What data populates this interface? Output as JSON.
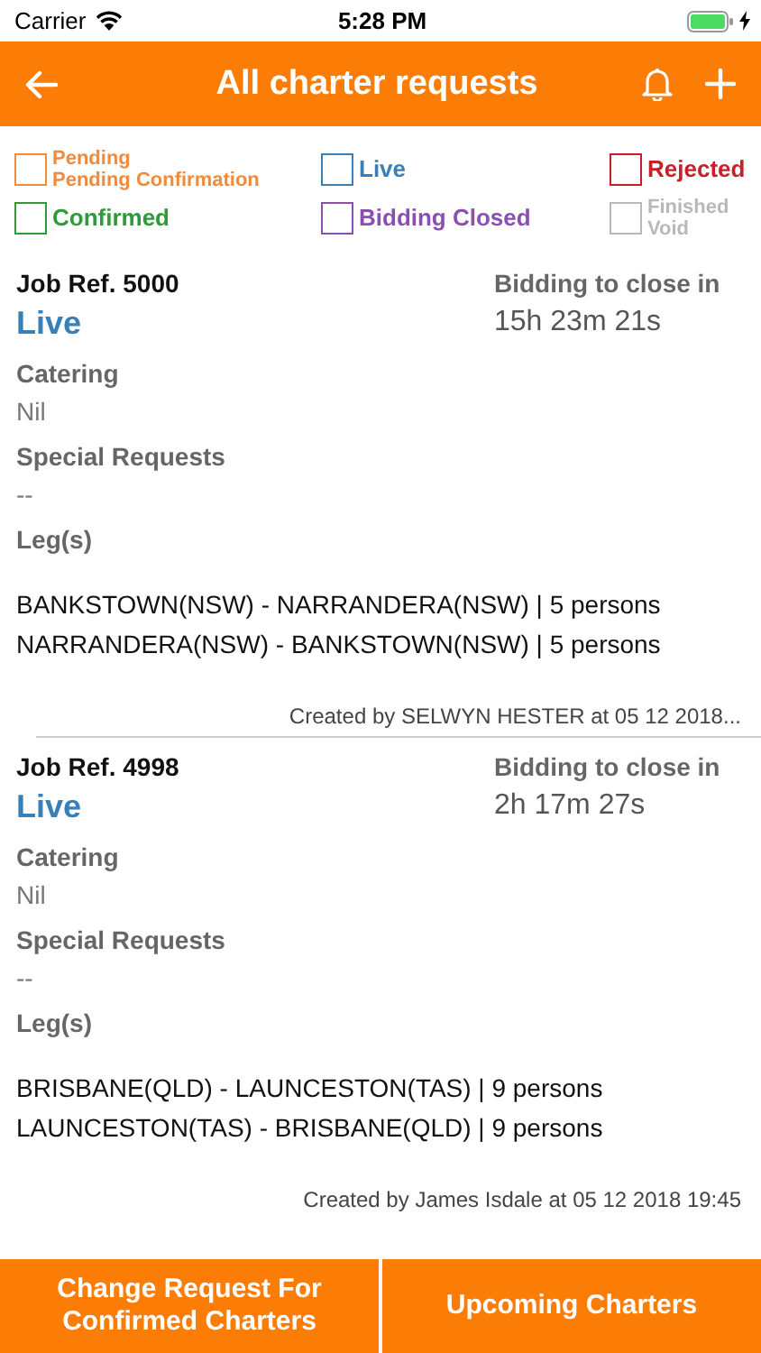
{
  "status_bar": {
    "carrier": "Carrier",
    "time": "5:28 PM"
  },
  "header": {
    "title": "All charter requests"
  },
  "legend": [
    {
      "label": "Pending\nPending Confirmation",
      "color": "#f08a3c"
    },
    {
      "label": "Live",
      "color": "#3a80b8"
    },
    {
      "label": "Rejected",
      "color": "#c8202a"
    },
    {
      "label": "Confirmed",
      "color": "#2e9a3a"
    },
    {
      "label": "Bidding Closed",
      "color": "#8a4fb0"
    },
    {
      "label": "Finished\nVoid",
      "color": "#b8b8b8"
    }
  ],
  "requests": [
    {
      "job_ref": "Job Ref. 5000",
      "status": "Live",
      "color": "#3a80b8",
      "countdown_label": "Bidding to close in",
      "countdown": "15h 23m 21s",
      "catering_label": "Catering",
      "catering": "Nil",
      "special_label": "Special Requests",
      "special": "--",
      "legs_label": "Leg(s)",
      "legs": [
        "BANKSTOWN(NSW) - NARRANDERA(NSW) | 5 persons",
        "NARRANDERA(NSW) - BANKSTOWN(NSW) | 5 persons"
      ],
      "created": "Created by SELWYN HESTER at 05 12 2018..."
    },
    {
      "job_ref": "Job Ref. 4998",
      "status": "Live",
      "color": "#3a80b8",
      "countdown_label": "Bidding to close in",
      "countdown": "2h 17m 27s",
      "catering_label": "Catering",
      "catering": "Nil",
      "special_label": "Special Requests",
      "special": "--",
      "legs_label": "Leg(s)",
      "legs": [
        "BRISBANE(QLD) - LAUNCESTON(TAS) | 9 persons",
        "LAUNCESTON(TAS) - BRISBANE(QLD) | 9 persons"
      ],
      "created": "Created by James Isdale at 05 12 2018 19:45"
    }
  ],
  "bottom_buttons": [
    "Change Request For\nConfirmed Charters",
    "Upcoming Charters"
  ]
}
